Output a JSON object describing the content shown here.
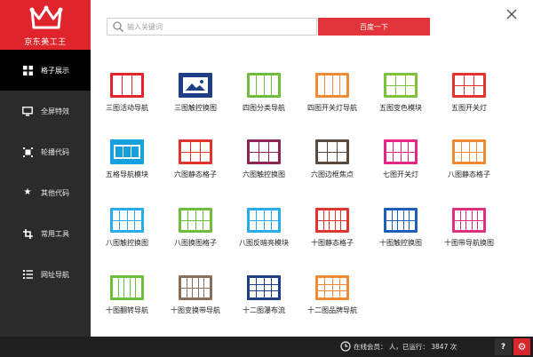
{
  "app": {
    "logo_text": "京东美工王",
    "brand_color": "#e0242b"
  },
  "search": {
    "placeholder": "输入关键词",
    "button_label": "百度一下"
  },
  "sidebar": {
    "items": [
      {
        "label": "格子展示",
        "icon": "grid-icon",
        "active": true
      },
      {
        "label": "全屏特效",
        "icon": "monitor-icon",
        "active": false
      },
      {
        "label": "轮播代码",
        "icon": "carousel-icon",
        "active": false
      },
      {
        "label": "其他代码",
        "icon": "star-icon",
        "active": false
      },
      {
        "label": "常用工具",
        "icon": "crop-tool-icon",
        "active": false
      },
      {
        "label": "网址导航",
        "icon": "list-icon",
        "active": false
      }
    ]
  },
  "tiles": [
    {
      "label": "三图活动导航",
      "color": "#e3242b",
      "icon": "three-panel-icon"
    },
    {
      "label": "三图触控换图",
      "color": "#1e3f86",
      "icon": "image-slider-icon"
    },
    {
      "label": "四图分类导航",
      "color": "#6cbe3c",
      "icon": "four-panel-icon"
    },
    {
      "label": "四图开关灯导航",
      "color": "#f08a34",
      "icon": "four-panel-icon"
    },
    {
      "label": "五图变色模块",
      "color": "#7ec23a",
      "icon": "five-panel-icon"
    },
    {
      "label": "五图开关灯",
      "color": "#e0342c",
      "icon": "five-panel-icon"
    },
    {
      "label": "五格导航模块",
      "color": "#18a0dc",
      "icon": "carousel-panel-icon"
    },
    {
      "label": "六图静态格子",
      "color": "#e0342c",
      "icon": "six-grid-icon"
    },
    {
      "label": "六图触控换图",
      "color": "#8e2455",
      "icon": "six-grid-icon"
    },
    {
      "label": "六图边框焦点",
      "color": "#5a4a3e",
      "icon": "six-grid-icon"
    },
    {
      "label": "七图开关灯",
      "color": "#e62585",
      "icon": "seven-grid-icon"
    },
    {
      "label": "八图静态格子",
      "color": "#f08a34",
      "icon": "eight-grid-icon"
    },
    {
      "label": "八图触控换图",
      "color": "#27aee8",
      "icon": "eight-grid-icon"
    },
    {
      "label": "八图换图格子",
      "color": "#6cbe3c",
      "icon": "eight-grid-icon"
    },
    {
      "label": "八图反暗亮模块",
      "color": "#27aee8",
      "icon": "eight-grid-icon"
    },
    {
      "label": "十图静态格子",
      "color": "#e0342c",
      "icon": "ten-grid-icon"
    },
    {
      "label": "十图触控换图",
      "color": "#1e5fb8",
      "icon": "ten-grid-icon"
    },
    {
      "label": "十图带导航换图",
      "color": "#e0307a",
      "icon": "ten-grid-icon"
    },
    {
      "label": "十图翻转导航",
      "color": "#6cbe3c",
      "icon": "ten-strip-icon"
    },
    {
      "label": "十图变换带导航",
      "color": "#8a6e5e",
      "icon": "ten-grid-icon"
    },
    {
      "label": "十二图瀑布流",
      "color": "#1e3f86",
      "icon": "twelve-grid-icon"
    },
    {
      "label": "十二图品牌导航",
      "color": "#f08a34",
      "icon": "twelve-grid-icon"
    }
  ],
  "status": {
    "online_text": "在线会员：  人，已运行： 3847  次",
    "help_label": "?",
    "settings_color": "#d9262d"
  }
}
